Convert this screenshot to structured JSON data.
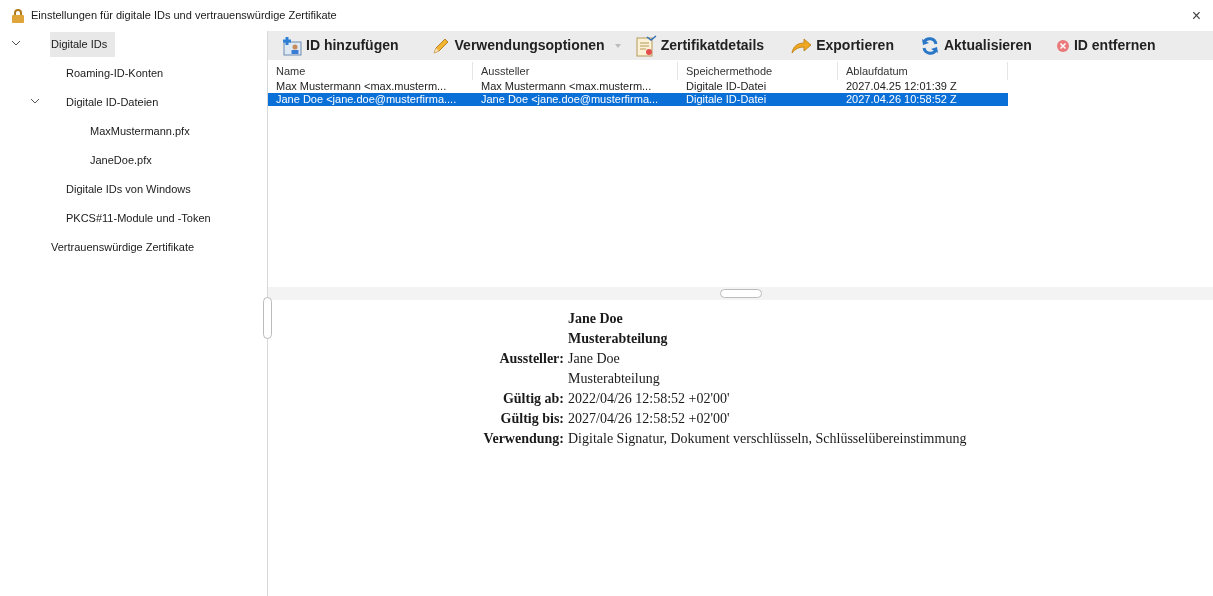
{
  "window": {
    "title": "Einstellungen für digitale IDs und vertrauenswürdige Zertifikate",
    "close": "×"
  },
  "sidebar": {
    "items": [
      {
        "label": "Digitale IDs",
        "selected": true,
        "expanded": true,
        "children": [
          {
            "label": "Roaming-ID-Konten",
            "selected": false
          },
          {
            "label": "Digitale ID-Dateien",
            "selected": false,
            "expanded": true,
            "children": [
              {
                "label": "MaxMustermann.pfx",
                "selected": false
              },
              {
                "label": "JaneDoe.pfx",
                "selected": false
              }
            ]
          },
          {
            "label": "Digitale IDs von Windows",
            "selected": false
          },
          {
            "label": "PKCS#11-Module und -Token",
            "selected": false
          }
        ]
      },
      {
        "label": "Vertrauenswürdige Zertifikate",
        "selected": false
      }
    ]
  },
  "toolbar": [
    {
      "kind": "add",
      "label": "ID hinzufügen",
      "menu": false
    },
    {
      "kind": "pencil",
      "label": "Verwendungsoptionen",
      "menu": true
    },
    {
      "kind": "certificate",
      "label": "Zertifikatdetails",
      "menu": false
    },
    {
      "kind": "export",
      "label": "Exportieren",
      "menu": false
    },
    {
      "kind": "refresh",
      "label": "Aktualisieren",
      "menu": false
    },
    {
      "kind": "remove",
      "label": "ID entfernen",
      "menu": false
    }
  ],
  "table": {
    "columns": [
      "Name",
      "Aussteller",
      "Speichermethode",
      "Ablaufdatum"
    ],
    "rows": [
      {
        "cells": [
          "Max Mustermann <max.musterm...",
          "Max Mustermann <max.musterm...",
          "Digitale ID-Datei",
          "2027.04.25 12:01:39 Z"
        ],
        "selected": false
      },
      {
        "cells": [
          "Jane Doe <jane.doe@musterfirma....",
          "Jane Doe <jane.doe@musterfirma...",
          "Digitale ID-Datei",
          "2027.04.26 10:58:52 Z"
        ],
        "selected": true
      }
    ]
  },
  "details": {
    "subject": [
      "Jane Doe",
      "Musterabteilung"
    ],
    "fields": [
      {
        "label": "Aussteller:",
        "values": [
          "Jane Doe",
          "Musterabteilung"
        ]
      },
      {
        "label": "Gültig ab:",
        "values": [
          "2022/04/26 12:58:52 +02'00'"
        ]
      },
      {
        "label": "Gültig bis:",
        "values": [
          "2027/04/26 12:58:52 +02'00'"
        ]
      },
      {
        "label": "Verwendung:",
        "values": [
          "Digitale Signatur, Dokument verschlüsseln, Schlüsselübereinstimmung"
        ]
      }
    ]
  }
}
